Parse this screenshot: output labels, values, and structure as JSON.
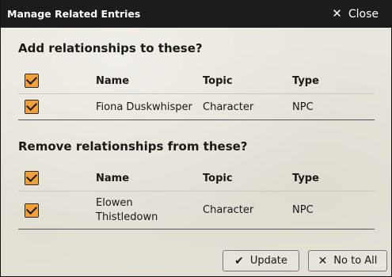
{
  "dialog": {
    "title": "Manage Related Entries",
    "close_label": "Close"
  },
  "add_section": {
    "heading": "Add relationships to these?",
    "columns": [
      "Name",
      "Topic",
      "Type"
    ],
    "rows": [
      {
        "name": "Fiona Duskwhisper",
        "topic": "Character",
        "type": "NPC"
      }
    ]
  },
  "remove_section": {
    "heading": "Remove relationships from these?",
    "columns": [
      "Name",
      "Topic",
      "Type"
    ],
    "rows": [
      {
        "name_line1": "Elowen",
        "name_line2": "Thistledown",
        "topic": "Character",
        "type": "NPC"
      }
    ]
  },
  "buttons": {
    "update_label": "Update",
    "no_to_all_label": "No to All"
  },
  "icons": {
    "close": "close-icon",
    "check": "checkmark-icon",
    "times": "times-icon"
  },
  "colors": {
    "checkbox_fill": "#f2a03a",
    "titlebar": "#1c1c1c"
  }
}
